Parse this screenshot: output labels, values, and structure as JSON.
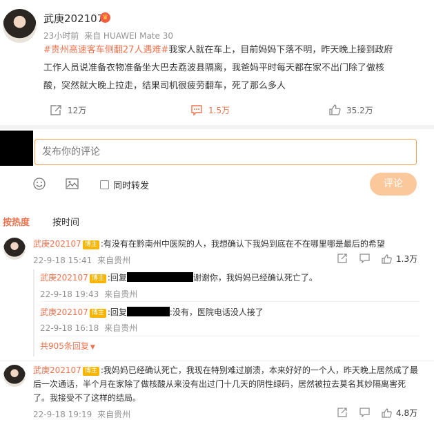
{
  "post": {
    "username": "武庚202107",
    "time": "23小时前",
    "source": "来自 HUAWEI Mate 30",
    "topic": "#贵州高速客车侧翻27人遇难#",
    "text_lines": [
      "我家人就在车上，目前妈妈下落不明，昨天晚上接到政府",
      "工作人员说准备衣物准备坐大巴去荔波县隔离，我爸妈平时每天都在家不出门除了做核",
      "酸，突然就大晚上拉走，结果司机很疲劳翻车，死了那么多人"
    ],
    "reposts": "12万",
    "comments": "1.5万",
    "likes": "35.2万"
  },
  "compose": {
    "placeholder": "发布你的评论",
    "repost_label": "同时转发",
    "submit_label": "评论"
  },
  "tabs": {
    "hot": "按热度",
    "time": "按时间"
  },
  "comments": [
    {
      "username": "武庚202107",
      "badge": "博主",
      "text": "有没有在黔南州中医院的人，我想确认下我妈到底在不在哪里哪是最后的希望",
      "time": "22-9-18 15:41",
      "source": "来自贵州",
      "likes": "1.3万",
      "replies": [
        {
          "username": "武庚202107",
          "badge": "博主",
          "prefix": "回复",
          "text": "谢谢你，我妈妈已经确认死亡了。",
          "time": "22-9-18 19:43",
          "source": "来自贵州"
        },
        {
          "username": "武庚202107",
          "badge": "博主",
          "prefix": "回复",
          "text": ":没有，医院电话没人接了",
          "time": "22-9-18 16:18",
          "source": "来自贵州"
        }
      ],
      "more_replies": "共905条回复"
    },
    {
      "username": "武庚202107",
      "badge": "博主",
      "text_lines": [
        "我妈妈已经确认死亡，我现在特别难过崩溃，本来好好的一个人，昨天晚上居然成了最",
        "后一次通话，半个月在家除了做核酸从来没有出过门十几天的阴性绿码，居然被拉去莫名其妙隔离害死",
        "了。我接受不了这样的结局。"
      ],
      "time": "22-9-18 19:19",
      "source": "来自贵州",
      "likes": "4.8万"
    }
  ],
  "colors": {
    "accent": "#eb7350",
    "badge": "#f7b500",
    "submit_bg": "#fbc89b"
  }
}
